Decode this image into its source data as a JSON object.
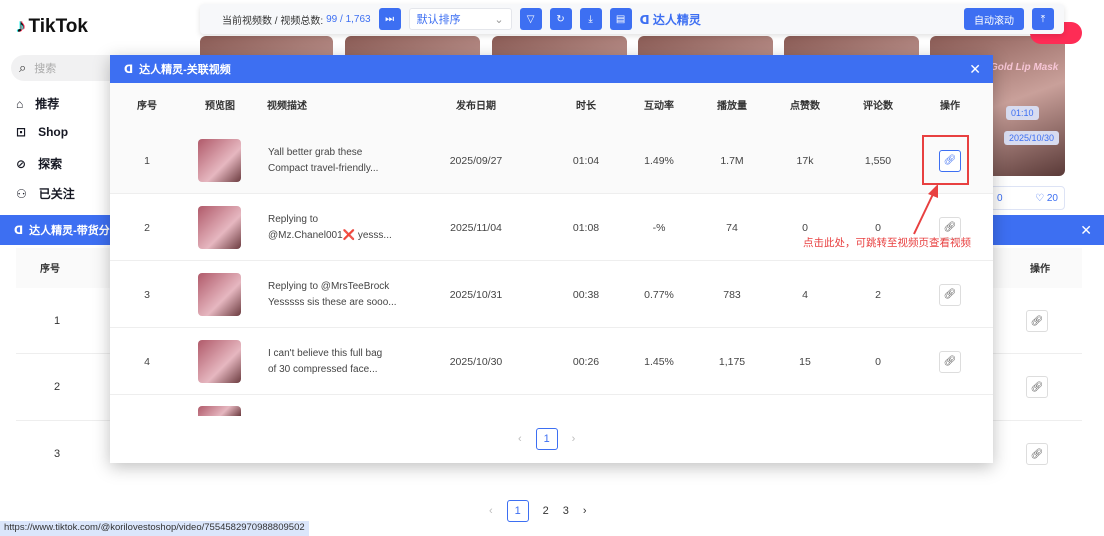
{
  "tiktok": {
    "logo": "TikTok",
    "search_placeholder": "搜索",
    "nav": [
      "推荐",
      "Shop",
      "探索",
      "已关注"
    ],
    "badges": {
      "duration": "01:10",
      "date": "2025/10/30",
      "overlay_text": "Gold Lip Mask",
      "comments": "0",
      "likes": "20"
    }
  },
  "toolbar": {
    "count_label": "当前视频数 / 视频总数:",
    "count_value": "99 / 1,763",
    "sort_value": "默认排序",
    "brand": "达人精灵",
    "auto_scroll": "自动滚动"
  },
  "back_modal": {
    "title": "达人精灵-带货分析",
    "headers": [
      "序号",
      "操作"
    ],
    "rows": [
      "1",
      "2",
      "3"
    ],
    "pagination": {
      "pages": [
        "1",
        "2",
        "3"
      ],
      "current": "1"
    }
  },
  "front_modal": {
    "title": "达人精灵-关联视频",
    "headers": [
      "序号",
      "预览图",
      "视频描述",
      "发布日期",
      "时长",
      "互动率",
      "播放量",
      "点赞数",
      "评论数",
      "操作"
    ],
    "rows": [
      {
        "idx": "1",
        "desc1": "Yall better grab these",
        "desc2": "Compact travel-friendly...",
        "date": "2025/09/27",
        "dur": "01:04",
        "rate": "1.49%",
        "plays": "1.7M",
        "likes": "17k",
        "comments": "1,550"
      },
      {
        "idx": "2",
        "desc1": "Replying to",
        "desc2": "@Mz.Chanel001❌ yesss...",
        "date": "2025/11/04",
        "dur": "01:08",
        "rate": "-%",
        "plays": "74",
        "likes": "0",
        "comments": "0"
      },
      {
        "idx": "3",
        "desc1": "Replying to @MrsTeeBrock",
        "desc2": "Yesssss sis these are sooo...",
        "date": "2025/10/31",
        "dur": "00:38",
        "rate": "0.77%",
        "plays": "783",
        "likes": "4",
        "comments": "2"
      },
      {
        "idx": "4",
        "desc1": "I can't believe this full bag",
        "desc2": "of 30 compressed face...",
        "date": "2025/10/30",
        "dur": "00:26",
        "rate": "1.45%",
        "plays": "1,175",
        "likes": "15",
        "comments": "0"
      }
    ],
    "pagination": {
      "current": "1"
    }
  },
  "annotation": {
    "text": "点击此处，可跳转至视频页查看视频",
    "color": "#e84040"
  },
  "status_url": "https://www.tiktok.com/@korilovestoshop/video/7554582970988809502",
  "colors": {
    "accent": "#3d6ff2"
  }
}
